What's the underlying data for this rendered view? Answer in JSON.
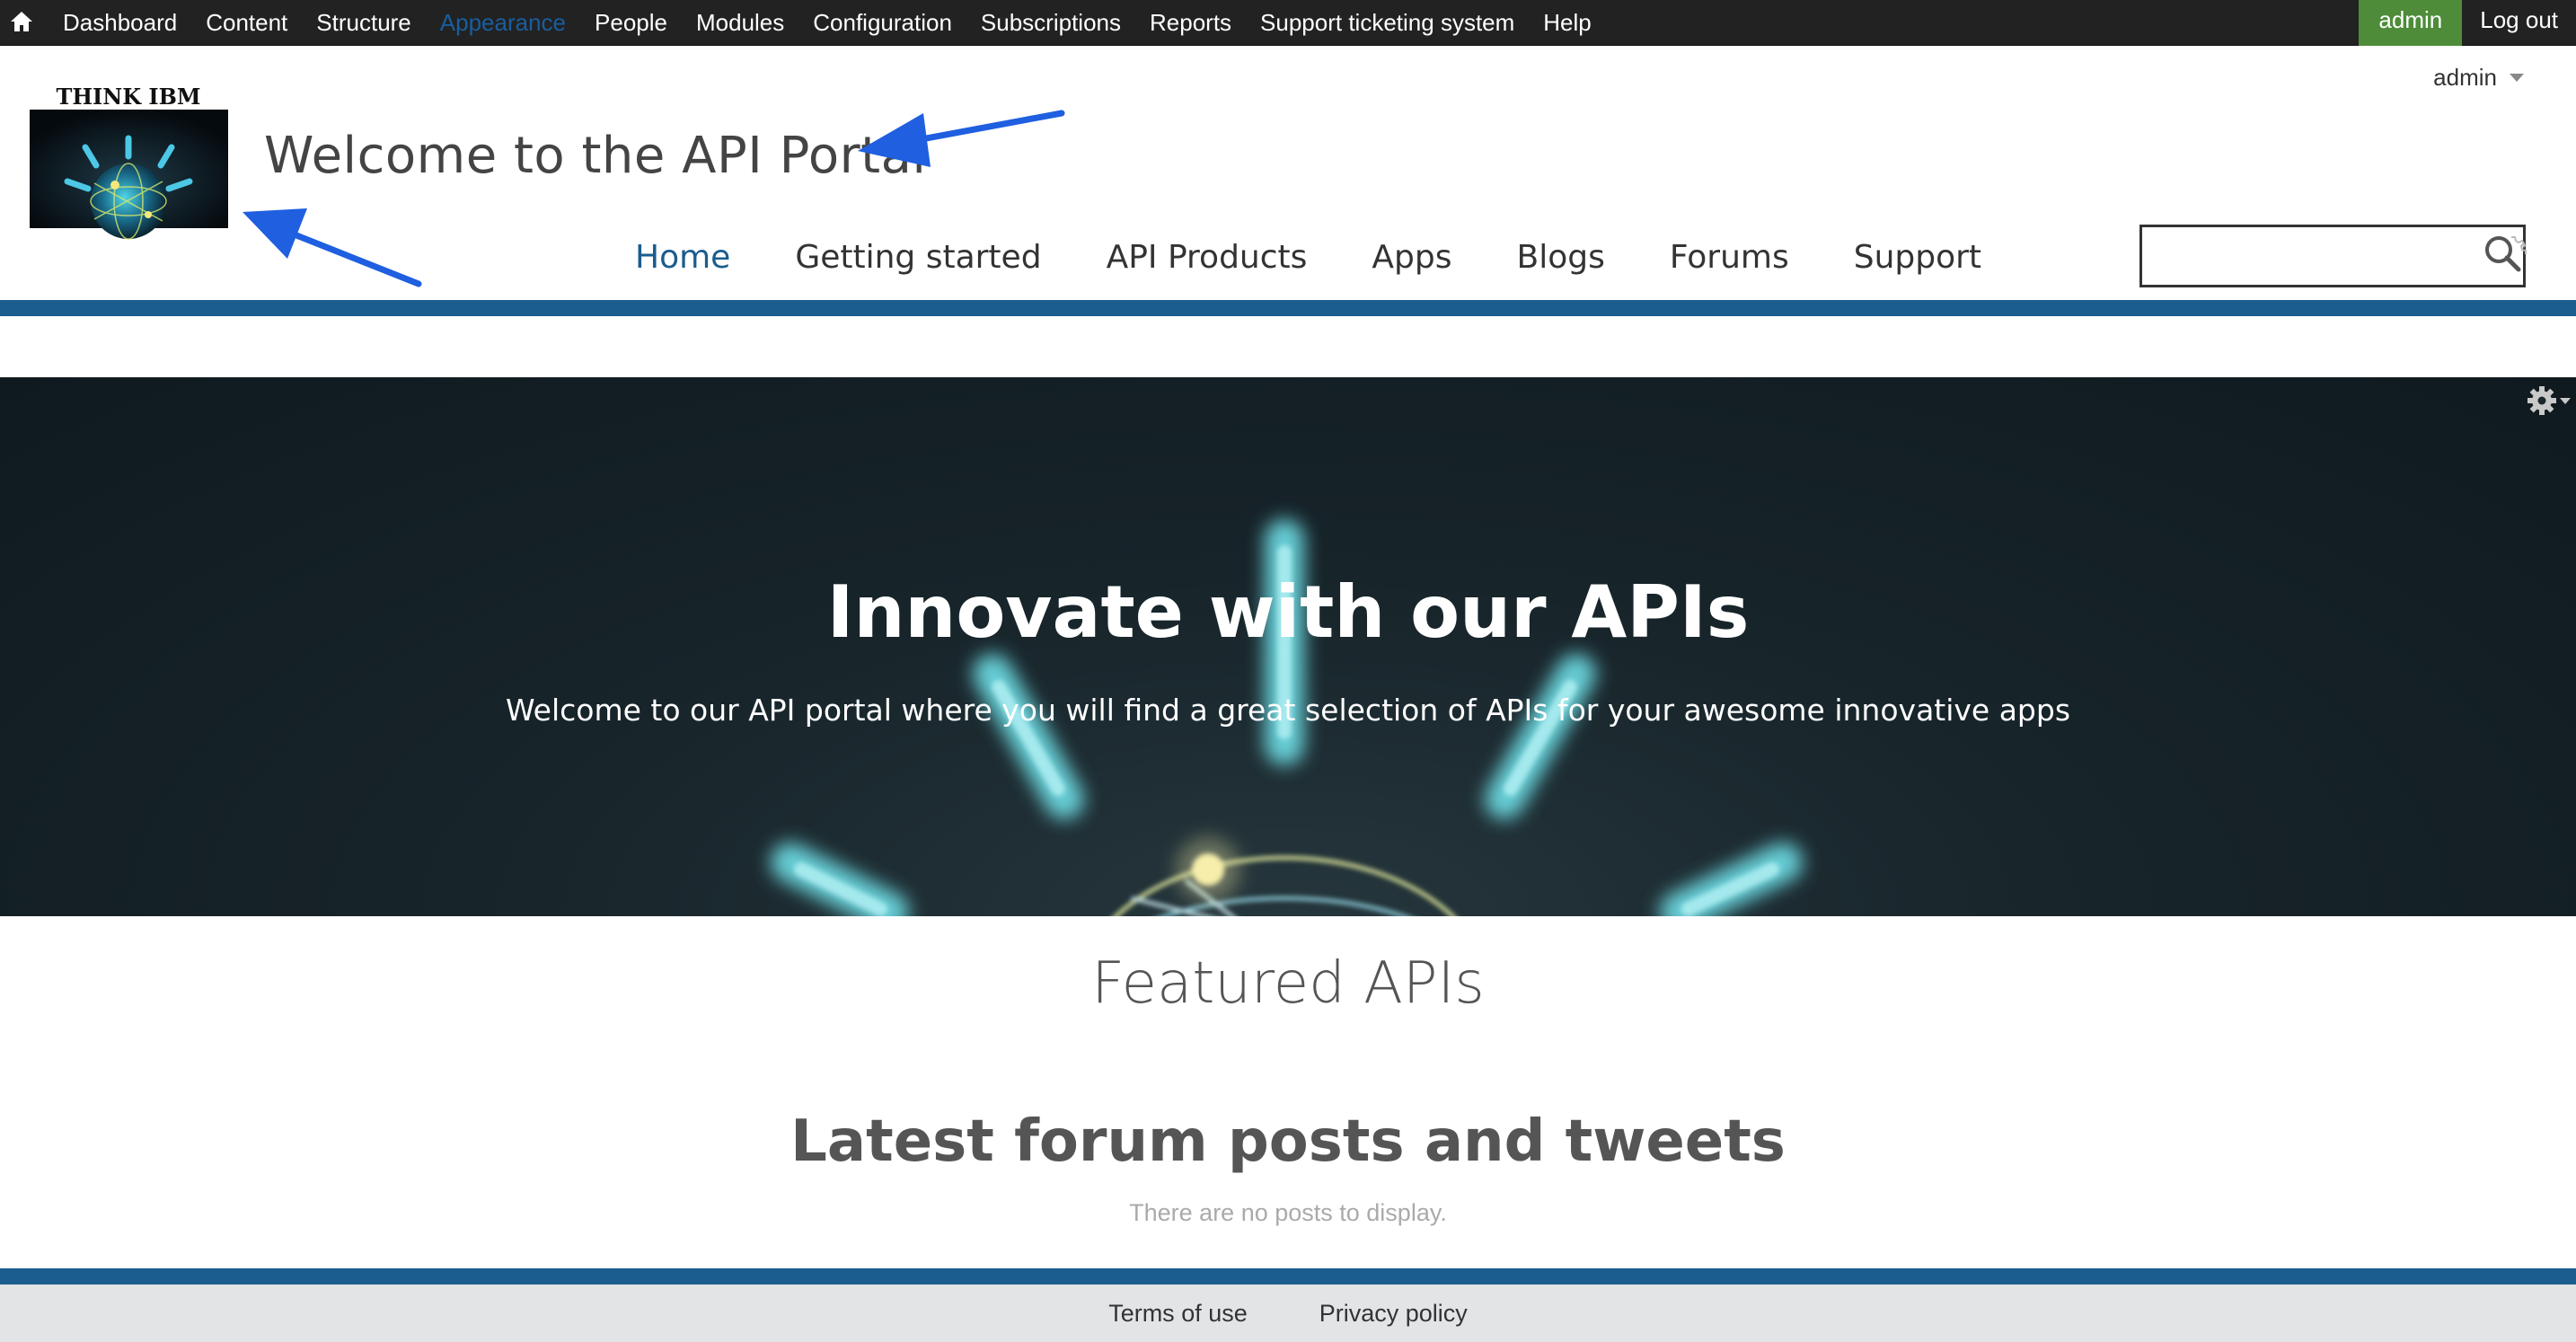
{
  "toolbar": {
    "home_icon": "home-icon",
    "items": [
      "Dashboard",
      "Content",
      "Structure",
      "Appearance",
      "People",
      "Modules",
      "Configuration",
      "Subscriptions",
      "Reports",
      "Support ticketing system",
      "Help"
    ],
    "active_item": "Appearance",
    "user_label": "admin",
    "logout_label": "Log out",
    "colors": {
      "background": "#222222",
      "active": "#1a5d9e",
      "user_badge": "#4e8c3a"
    }
  },
  "header": {
    "logo_text": "THINK IBM",
    "site_name": "Welcome to the API Portal",
    "user_menu": "admin",
    "nav": [
      "Home",
      "Getting started",
      "API Products",
      "Apps",
      "Blogs",
      "Forums",
      "Support"
    ],
    "active_nav": "Home",
    "search": {
      "value": "",
      "placeholder": "",
      "icon": "search-icon"
    },
    "colors": {
      "accent": "#1a5d8e"
    }
  },
  "hero": {
    "title": "Innovate with our APIs",
    "subtitle": "Welcome to our API portal where you will find a great selection of APIs for your awesome innovative apps",
    "gear_icon": "gear-icon"
  },
  "featured": {
    "title": "Featured APIs"
  },
  "latest": {
    "title": "Latest forum posts and tweets",
    "empty_text": "There are no posts to display."
  },
  "footer": {
    "links": [
      "Terms of use",
      "Privacy policy"
    ]
  }
}
